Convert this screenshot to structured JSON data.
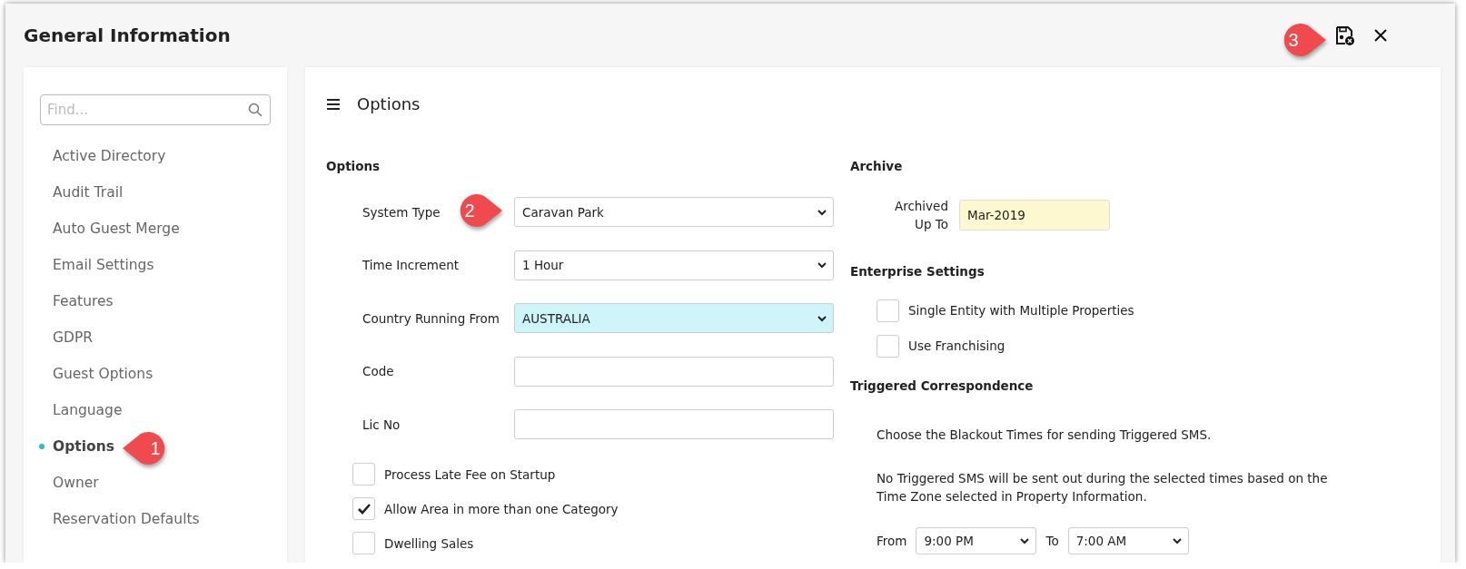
{
  "window": {
    "title": "General Information"
  },
  "sidebar": {
    "search": {
      "placeholder": "Find..."
    },
    "items": [
      {
        "label": "Active Directory",
        "selected": false
      },
      {
        "label": "Audit Trail",
        "selected": false
      },
      {
        "label": "Auto Guest Merge",
        "selected": false
      },
      {
        "label": "Email Settings",
        "selected": false
      },
      {
        "label": "Features",
        "selected": false
      },
      {
        "label": "GDPR",
        "selected": false
      },
      {
        "label": "Guest Options",
        "selected": false
      },
      {
        "label": "Language",
        "selected": false
      },
      {
        "label": "Options",
        "selected": true
      },
      {
        "label": "Owner",
        "selected": false
      },
      {
        "label": "Reservation Defaults",
        "selected": false
      }
    ]
  },
  "panel": {
    "title": "Options",
    "options": {
      "heading": "Options",
      "fields": [
        {
          "label": "System Type",
          "kind": "select",
          "value": "Caravan Park",
          "highlighted": false
        },
        {
          "label": "Time Increment",
          "kind": "select",
          "value": "1 Hour",
          "highlighted": false
        },
        {
          "label": "Country Running From",
          "kind": "select",
          "value": "AUSTRALIA",
          "highlighted": true
        },
        {
          "label": "Code",
          "kind": "text",
          "highlighted": false
        },
        {
          "label": "Lic No",
          "kind": "text",
          "highlighted": false
        }
      ],
      "checkboxes": [
        {
          "label": "Process Late Fee on Startup",
          "checked": false
        },
        {
          "label": "Allow Area in more than one Category",
          "checked": true
        },
        {
          "label": "Dwelling Sales",
          "checked": false
        }
      ]
    },
    "archive": {
      "heading": "Archive",
      "label": "Archived Up To",
      "value": "Mar-2019"
    },
    "enterprise": {
      "heading": "Enterprise Settings",
      "checkboxes": [
        {
          "label": "Single Entity with Multiple Properties",
          "checked": false
        },
        {
          "label": "Use Franchising",
          "checked": false
        }
      ]
    },
    "triggered": {
      "heading": "Triggered Correspondence",
      "intro": "Choose the Blackout Times for sending Triggered SMS.",
      "note": "No Triggered SMS will be sent out during the selected times based on the Time Zone selected in Property Information.",
      "from_label": "From",
      "from_value": "9:00 PM",
      "to_label": "To",
      "to_value": "7:00 AM"
    }
  },
  "callouts": [
    {
      "number": "1"
    },
    {
      "number": "2"
    },
    {
      "number": "3"
    }
  ]
}
